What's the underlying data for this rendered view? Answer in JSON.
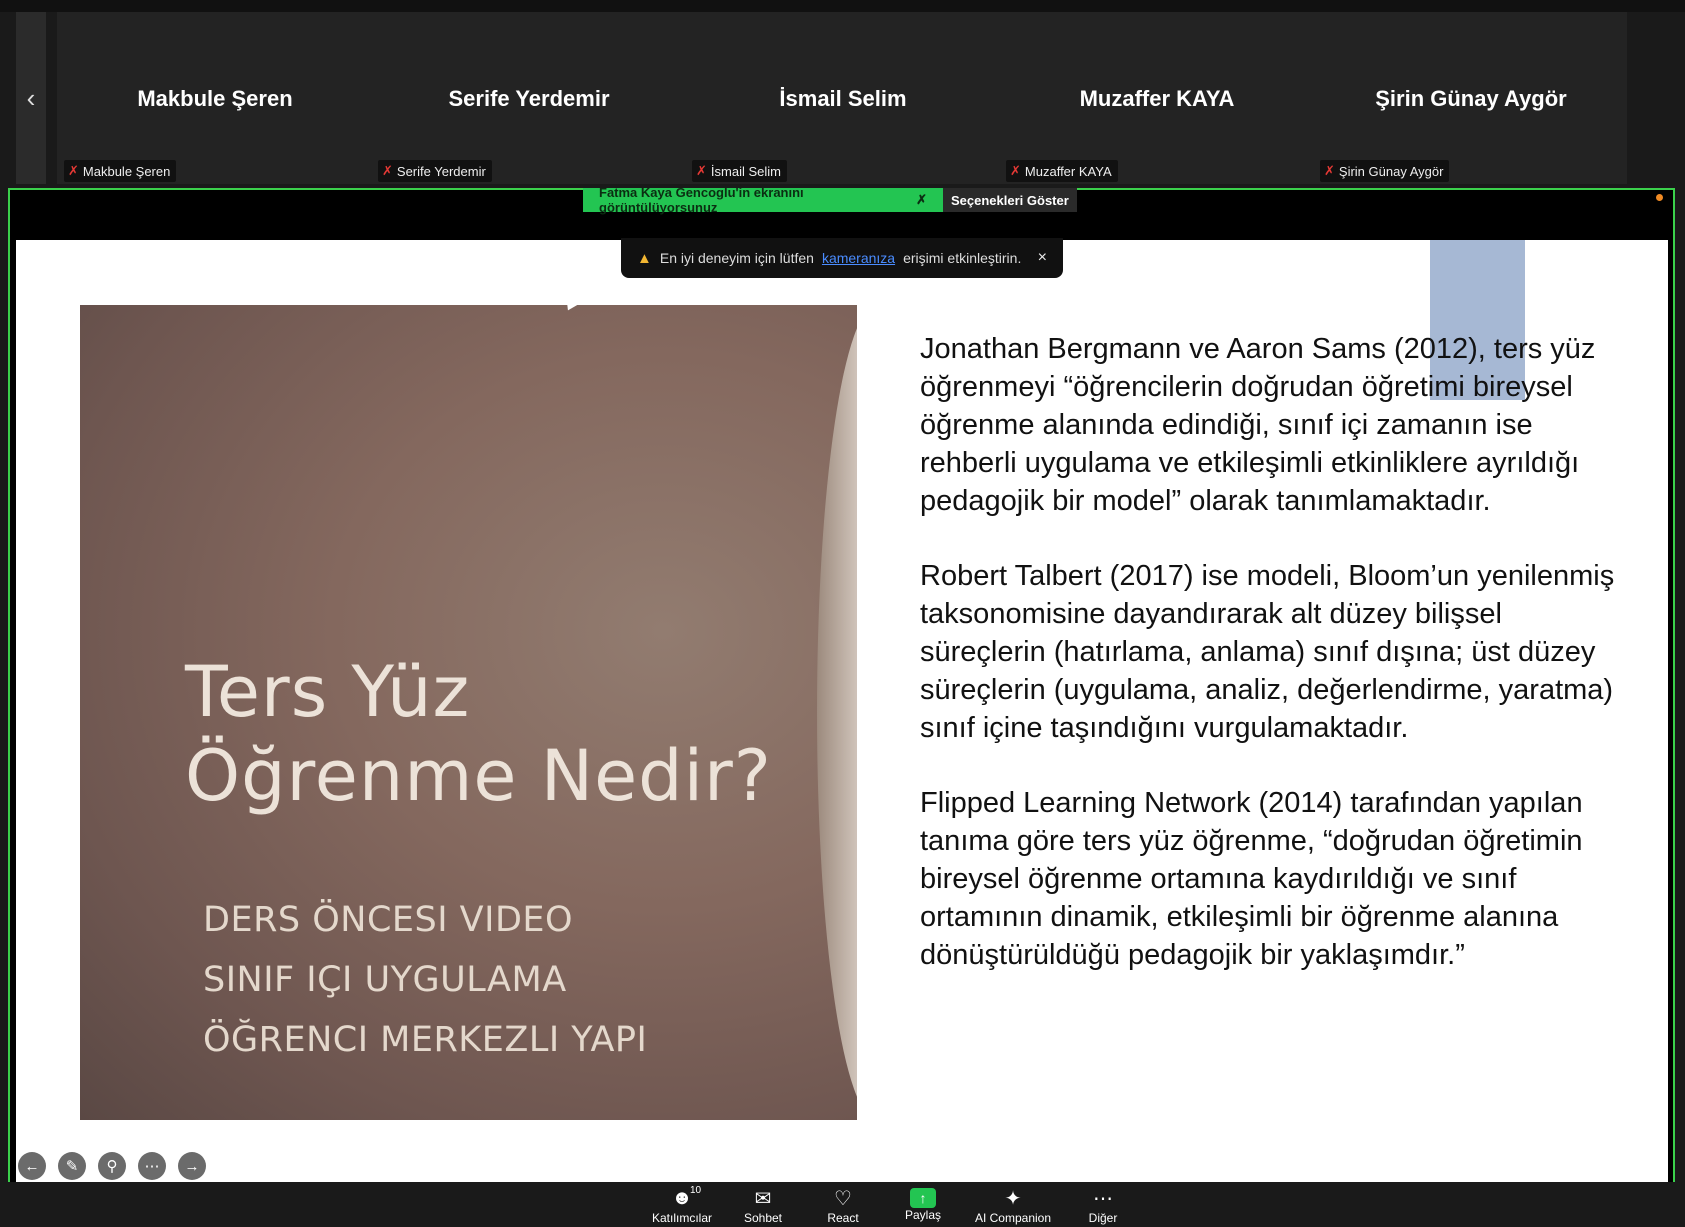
{
  "participants": [
    {
      "name": "Makbule Şeren",
      "tag": "Makbule Şeren"
    },
    {
      "name": "Serife Yerdemir",
      "tag": "Serife Yerdemir"
    },
    {
      "name": "İsmail Selim",
      "tag": "İsmail Selim"
    },
    {
      "name": "Muzaffer KAYA",
      "tag": "Muzaffer KAYA"
    },
    {
      "name": "Şirin Günay Aygör",
      "tag": "Şirin Günay Aygör"
    }
  ],
  "share_banner": {
    "text": "Fatma Kaya Gencoglu'in ekranını görüntülüyorsunuz",
    "options": "Seçenekleri Göster"
  },
  "camera_toast": {
    "before": "En iyi deneyim için lütfen",
    "link": "kameranıza",
    "after": "erişimi etkinleştirin.",
    "close": "×"
  },
  "slide": {
    "title_line1": "Ters Yüz",
    "title_line2": "Öğrenme Nedir?",
    "bullets": [
      "DERS ÖNCESI VIDEO",
      "SINIF IÇI UYGULAMA",
      "ÖĞRENCI MERKEZLI YAPI"
    ],
    "paragraphs": [
      "Jonathan Bergmann ve Aaron Sams (2012), ters yüz öğrenmeyi “öğrencilerin doğrudan öğretimi bireysel öğrenme alanında edindiği, sınıf içi zamanın ise rehberli uygulama ve etkileşimli etkinliklere ayrıldığı pedagojik bir model” olarak tanımlamaktadır.",
      "Robert Talbert (2017) ise modeli, Bloom’un yenilenmiş taksonomisine dayandırarak alt düzey bilişsel süreçlerin (hatırlama, anlama) sınıf dışına; üst düzey süreçlerin (uygulama, analiz, değerlendirme, yaratma) sınıf içine taşındığını vurgulamaktadır.",
      "Flipped Learning Network (2014) tarafından yapılan tanıma göre ters yüz öğrenme, “doğrudan öğretimin bireysel öğrenme ortamına kaydırıldığı ve sınıf ortamının dinamik, etkileşimli bir öğrenme alanına dönüştürüldüğü pedagojik bir yaklaşımdır.”"
    ]
  },
  "annotation_tools": [
    "prev-icon",
    "pencil-icon",
    "zoom-icon",
    "more-icon",
    "next-icon"
  ],
  "toolbar": {
    "participants_label": "Katılımcılar",
    "participants_count": "10",
    "chat_label": "Sohbet",
    "react_label": "React",
    "share_label": "Paylaş",
    "ai_label": "AI Companion",
    "more_label": "Diğer"
  }
}
